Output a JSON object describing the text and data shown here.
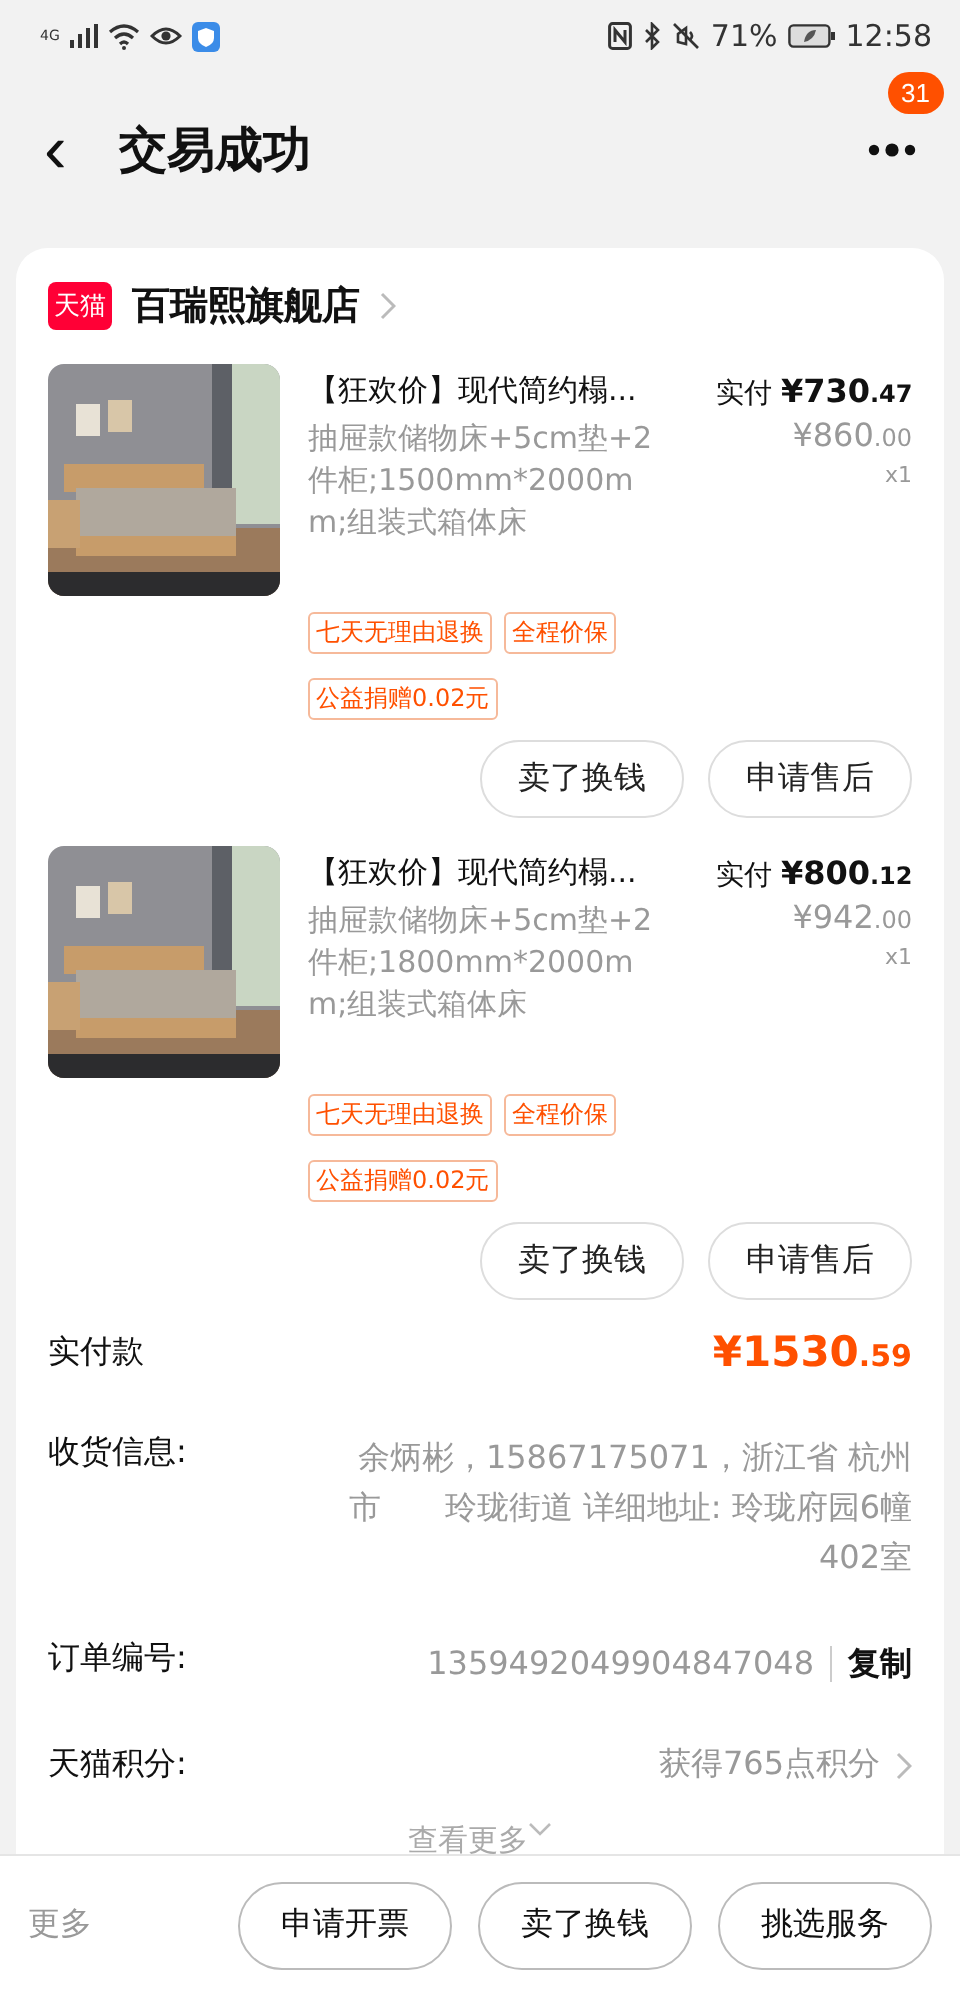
{
  "status_bar": {
    "network": "4G",
    "battery_percent": "71%",
    "time": "12:58"
  },
  "header": {
    "back": "‹",
    "title": "交易成功",
    "badge": "31"
  },
  "shop": {
    "logo": "天猫",
    "name": "百瑞熙旗舰店"
  },
  "items": [
    {
      "kind": "picture",
      "title": "【狂欢价】现代简约榻...",
      "desc": "抽屉款储物床+5cm垫+2件柜;1500mm*2000mm;组装式箱体床",
      "paid_label": "实付",
      "paid_int": "¥730",
      "paid_dec": ".47",
      "orig_int": "¥860",
      "orig_dec": ".00",
      "qty": "x1",
      "tags": [
        "七天无理由退换",
        "全程价保"
      ],
      "charity": "公益捐赠0.02元",
      "buttons": [
        "卖了换钱",
        "申请售后"
      ]
    },
    {
      "kind": "picture",
      "title": "【狂欢价】现代简约榻...",
      "desc": "抽屉款储物床+5cm垫+2件柜;1800mm*2000mm;组装式箱体床",
      "paid_label": "实付",
      "paid_int": "¥800",
      "paid_dec": ".12",
      "orig_int": "¥942",
      "orig_dec": ".00",
      "qty": "x1",
      "tags": [
        "七天无理由退换",
        "全程价保"
      ],
      "charity": "公益捐赠0.02元",
      "buttons": [
        "卖了换钱",
        "申请售后"
      ]
    }
  ],
  "total": {
    "label": "实付款",
    "int": "¥1530",
    "dec": ".59"
  },
  "info": [
    {
      "kind": "address",
      "label": "收货信息:",
      "value": "余炳彬，15867175071，浙江省 杭州市　　玲珑街道 详细地址: 玲珑府园6幢402室"
    },
    {
      "kind": "order",
      "label": "订单编号:",
      "value": "1359492049904847048",
      "action": "复制"
    },
    {
      "kind": "points",
      "label": "天猫积分:",
      "value": "获得765点积分"
    }
  ],
  "more_link": "查看更多",
  "bottom_bar": {
    "more": "更多",
    "buttons": [
      "申请开票",
      "卖了换钱",
      "挑选服务"
    ]
  }
}
